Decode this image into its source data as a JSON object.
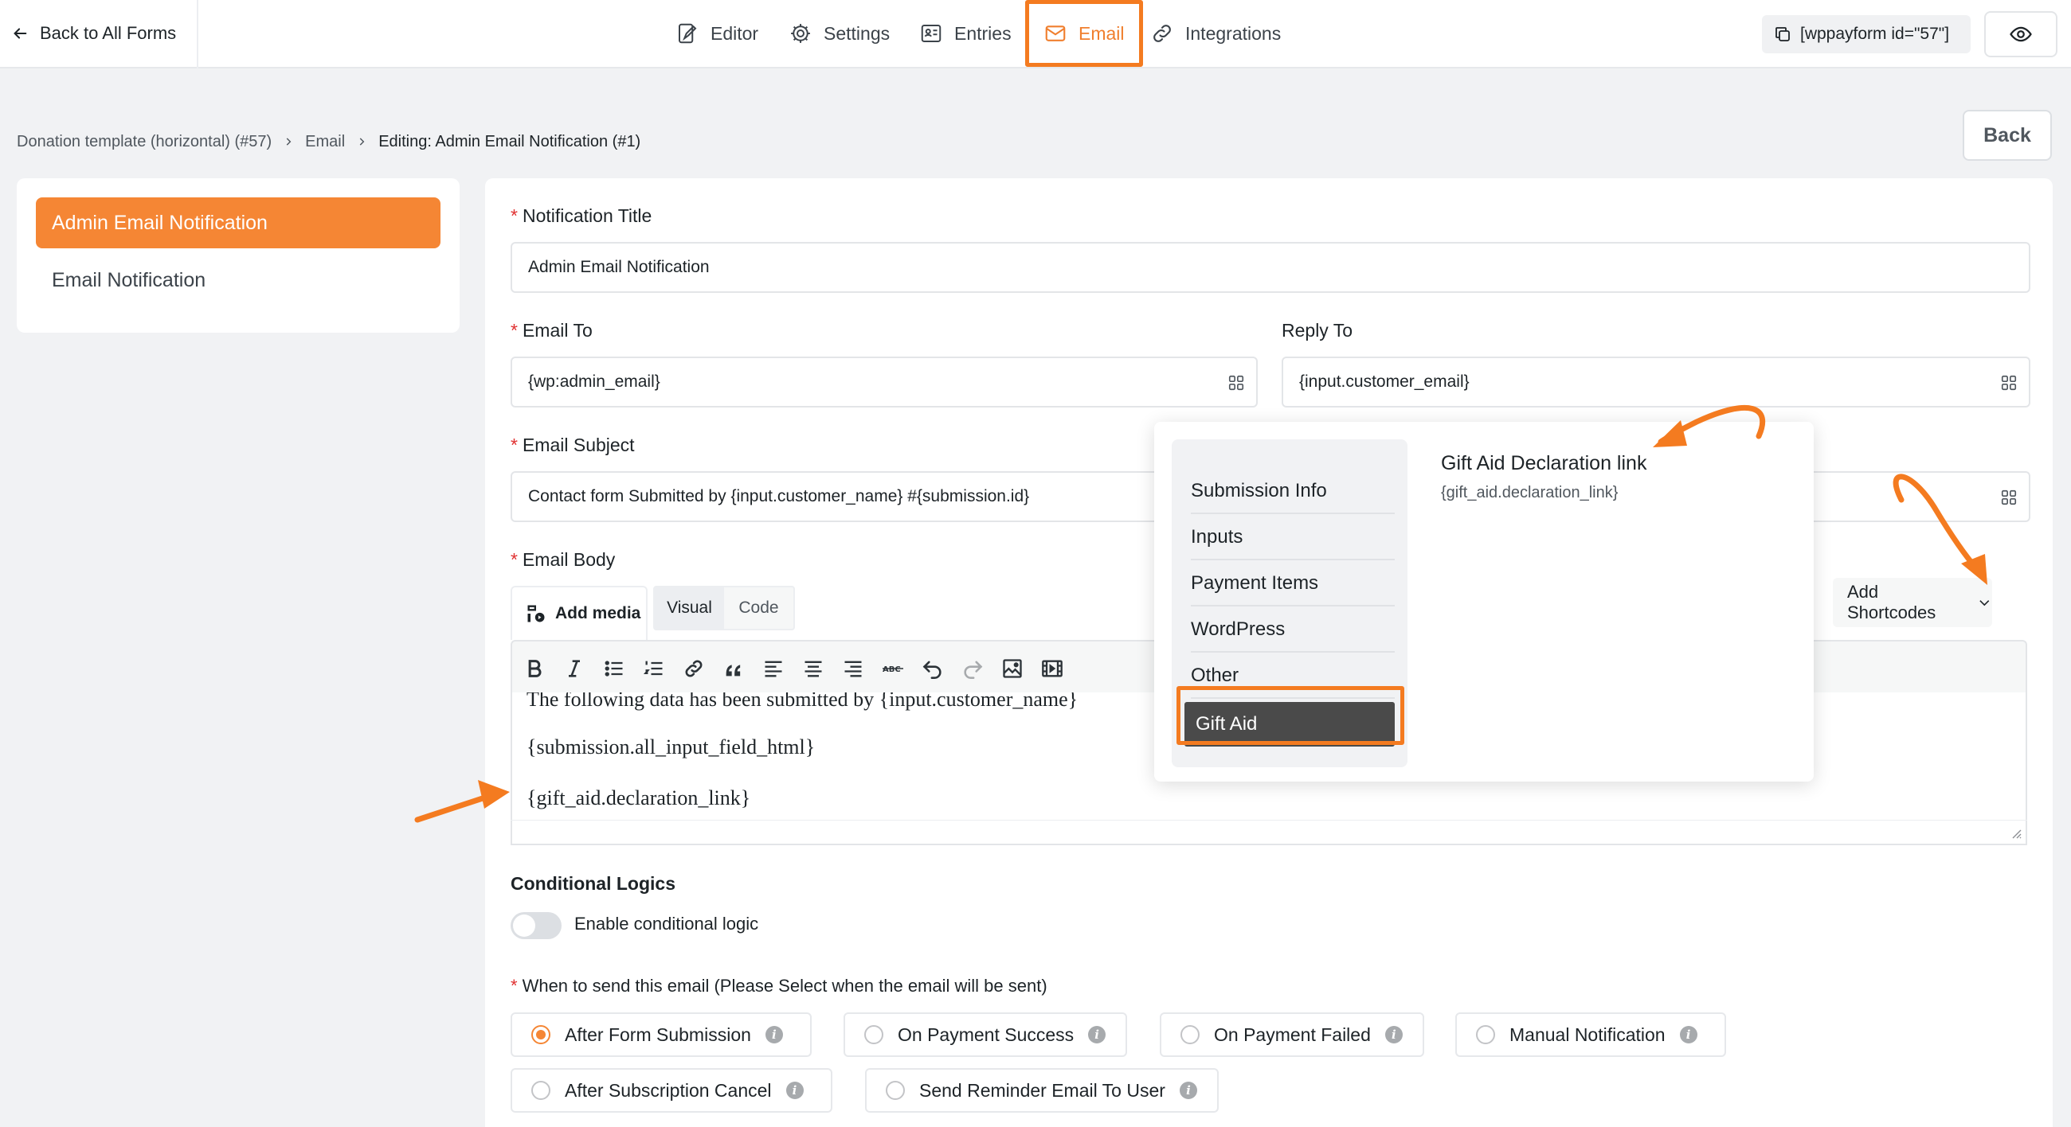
{
  "topbar": {
    "back_label": "Back to All Forms",
    "nav": {
      "editor": "Editor",
      "settings": "Settings",
      "entries": "Entries",
      "email": "Email",
      "integrations": "Integrations"
    },
    "shortcode": "[wppayform id=\"57\"]"
  },
  "breadcrumb": {
    "form": "Donation template (horizontal) (#57)",
    "section": "Email",
    "current": "Editing: Admin Email Notification (#1)"
  },
  "back_button": "Back",
  "sidebar": {
    "items": [
      {
        "label": "Admin Email Notification",
        "active": true
      },
      {
        "label": "Email Notification",
        "active": false
      }
    ]
  },
  "form": {
    "notification_title_label": "Notification Title",
    "notification_title_value": "Admin Email Notification",
    "email_to_label": "Email To",
    "email_to_value": "{wp:admin_email}",
    "reply_to_label": "Reply To",
    "reply_to_value": "{input.customer_email}",
    "email_subject_label": "Email Subject",
    "email_subject_value": "Contact form Submitted by {input.customer_name} #{submission.id}",
    "email_body_label": "Email Body",
    "add_media": "Add media",
    "visual_tab": "Visual",
    "code_tab": "Code",
    "add_shortcodes": "Add Shortcodes",
    "body_lines": [
      "The following data has been submitted by {input.customer_name}",
      "{submission.all_input_field_html}",
      "{gift_aid.declaration_link}"
    ],
    "conditional_label": "Conditional Logics",
    "conditional_toggle_label": "Enable conditional logic",
    "conditional_enabled": false,
    "when_label": "When to send this email (Please Select when the email will be sent)",
    "when_options": [
      {
        "label": "After Form Submission",
        "selected": true
      },
      {
        "label": "On Payment Success",
        "selected": false
      },
      {
        "label": "On Payment Failed",
        "selected": false
      },
      {
        "label": "Manual Notification",
        "selected": false
      },
      {
        "label": "After Subscription Cancel",
        "selected": false
      },
      {
        "label": "Send Reminder Email To User",
        "selected": false
      }
    ]
  },
  "shortcode_popover": {
    "categories": [
      {
        "label": "Submission Info",
        "selected": false
      },
      {
        "label": "Inputs",
        "selected": false
      },
      {
        "label": "Payment Items",
        "selected": false
      },
      {
        "label": "WordPress",
        "selected": false
      },
      {
        "label": "Other",
        "selected": false
      },
      {
        "label": "Gift Aid",
        "selected": true
      }
    ],
    "item_title": "Gift Aid Declaration link",
    "item_code": "{gift_aid.declaration_link}"
  },
  "colors": {
    "accent": "#f58634",
    "annotation": "#f47b20",
    "selected_category_bg": "#4a4a4a"
  },
  "icons": [
    "arrow-left-icon",
    "editor-icon",
    "gear-icon",
    "entries-icon",
    "envelope-icon",
    "link-icon",
    "copy-icon",
    "eye-icon",
    "chevron-right-icon",
    "grid-icon",
    "media-icon",
    "chevron-down-icon",
    "info-icon"
  ]
}
